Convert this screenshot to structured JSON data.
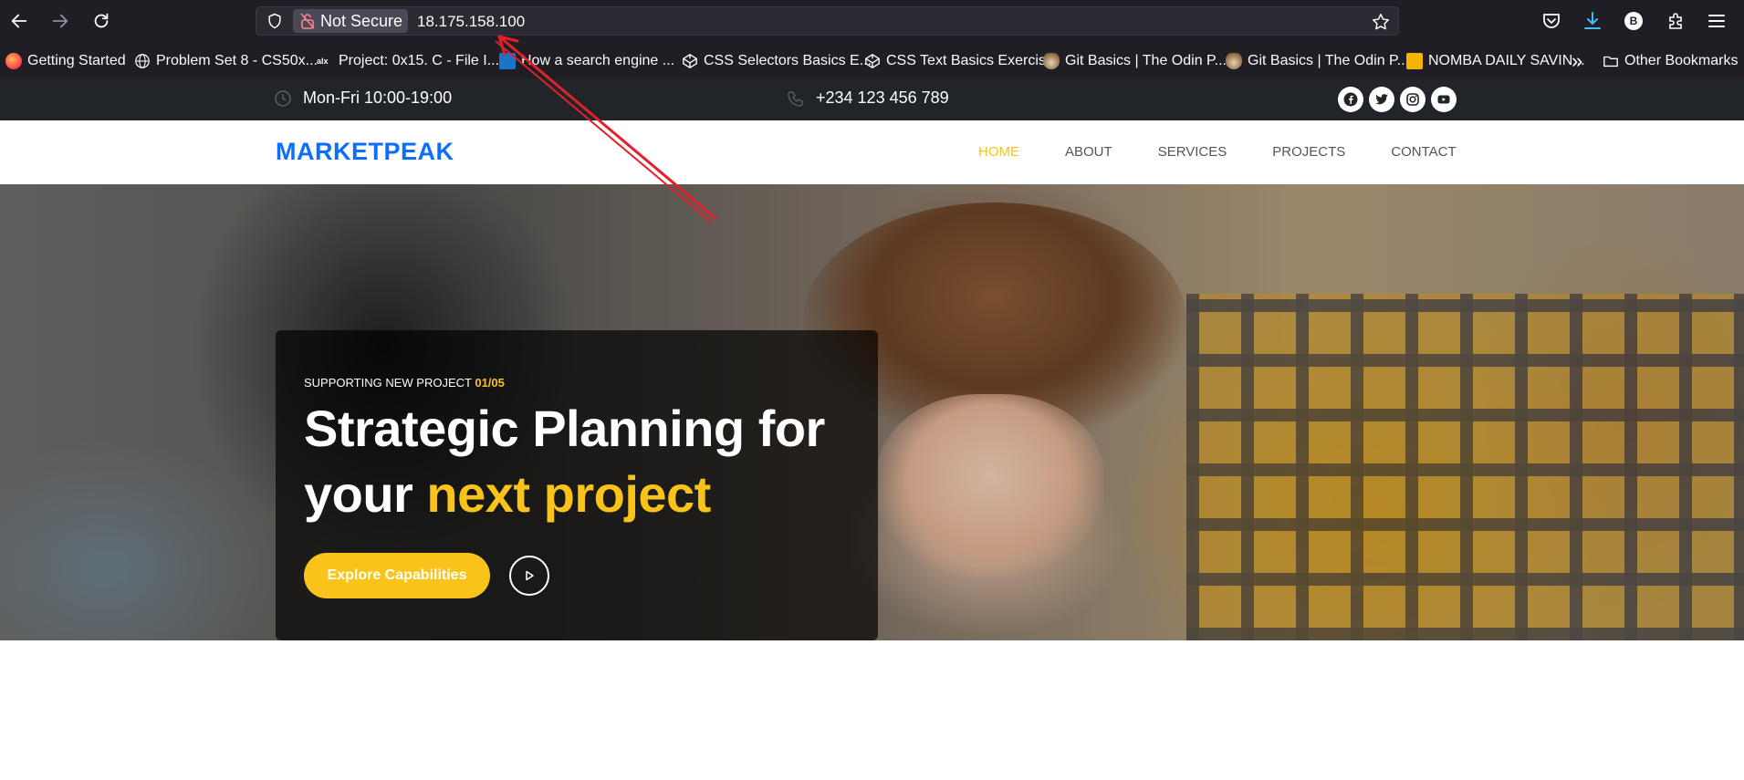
{
  "browser": {
    "security_label": "Not Secure",
    "url": "18.175.158.100",
    "profile_initial": "B",
    "bookmarks": [
      {
        "label": "Getting Started",
        "icon": "firefox-icon"
      },
      {
        "label": "Problem Set 8 - CS50x...",
        "icon": "globe-icon"
      },
      {
        "label": "Project: 0x15. C - File I...",
        "icon": "alx-icon"
      },
      {
        "label": "How a search engine ...",
        "icon": "image-icon"
      },
      {
        "label": "CSS Selectors Basics E...",
        "icon": "codepen-icon"
      },
      {
        "label": "CSS Text Basics Exercise",
        "icon": "codepen-icon"
      },
      {
        "label": "Git Basics | The Odin P...",
        "icon": "odin-icon"
      },
      {
        "label": "Git Basics | The Odin P...",
        "icon": "odin-icon"
      },
      {
        "label": "NOMBA DAILY SAVIN...",
        "icon": "slides-icon"
      }
    ],
    "overflow_label": "»",
    "other_bookmarks": "Other Bookmarks"
  },
  "site": {
    "topbar": {
      "hours": "Mon-Fri 10:00-19:00",
      "phone": "+234 123 456 789",
      "social": [
        "facebook-icon",
        "twitter-icon",
        "instagram-icon",
        "youtube-icon"
      ]
    },
    "brand": "MARKETPEAK",
    "nav": {
      "home": "HOME",
      "about": "ABOUT",
      "services": "SERVICES",
      "projects": "PROJECTS",
      "contact": "CONTACT"
    },
    "hero": {
      "eyebrow": "SUPPORTING NEW PROJECT",
      "counter": "01/05",
      "title_line1": "Strategic Planning for",
      "title_prefix": "your",
      "title_accent": "next project",
      "cta": "Explore Capabilities"
    }
  },
  "colors": {
    "accent": "#f9c31a",
    "brand": "#0d6efd",
    "topbar_bg": "#212529",
    "annotation_arrow": "#e0202a"
  }
}
